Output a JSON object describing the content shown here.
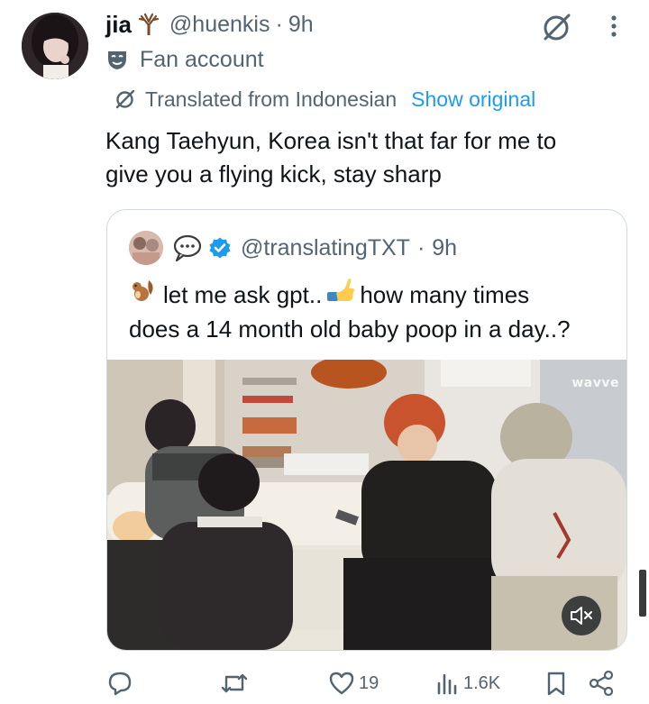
{
  "author": {
    "display_name": "jia",
    "name_emoji": "tree-emoji",
    "handle": "@huenkis",
    "separator": "·",
    "time": "9h",
    "label": "Fan account"
  },
  "translation": {
    "notice": "Translated from Indonesian",
    "show_original": "Show original"
  },
  "tweet": {
    "lines": [
      "Kang Taehyun, Korea isn't that far for me to",
      "give you a flying kick, stay sharp"
    ]
  },
  "quote": {
    "handle": "@translatingTXT",
    "separator": "·",
    "time": "9h",
    "line1_a": "let me ask gpt..",
    "line1_b": "how many times",
    "line2": "does a 14 month old baby poop in a day..?",
    "watermark": "wavve"
  },
  "actions": {
    "reply_count": "",
    "retweet_count": "",
    "like_count": "19",
    "views_count": "1.6K"
  },
  "colors": {
    "link": "#1d9bf0",
    "secondary_text": "#536471",
    "border": "#cfd9de",
    "verified": "#1d9bf0"
  },
  "icons": [
    "grok-icon",
    "more-icon",
    "mask-icon",
    "translate-icon",
    "speech-bubble-emoji",
    "verified-icon",
    "squirrel-emoji",
    "pointing-hand-emoji",
    "mute-icon",
    "reply-icon",
    "retweet-icon",
    "like-icon",
    "views-icon",
    "bookmark-icon",
    "share-icon"
  ]
}
